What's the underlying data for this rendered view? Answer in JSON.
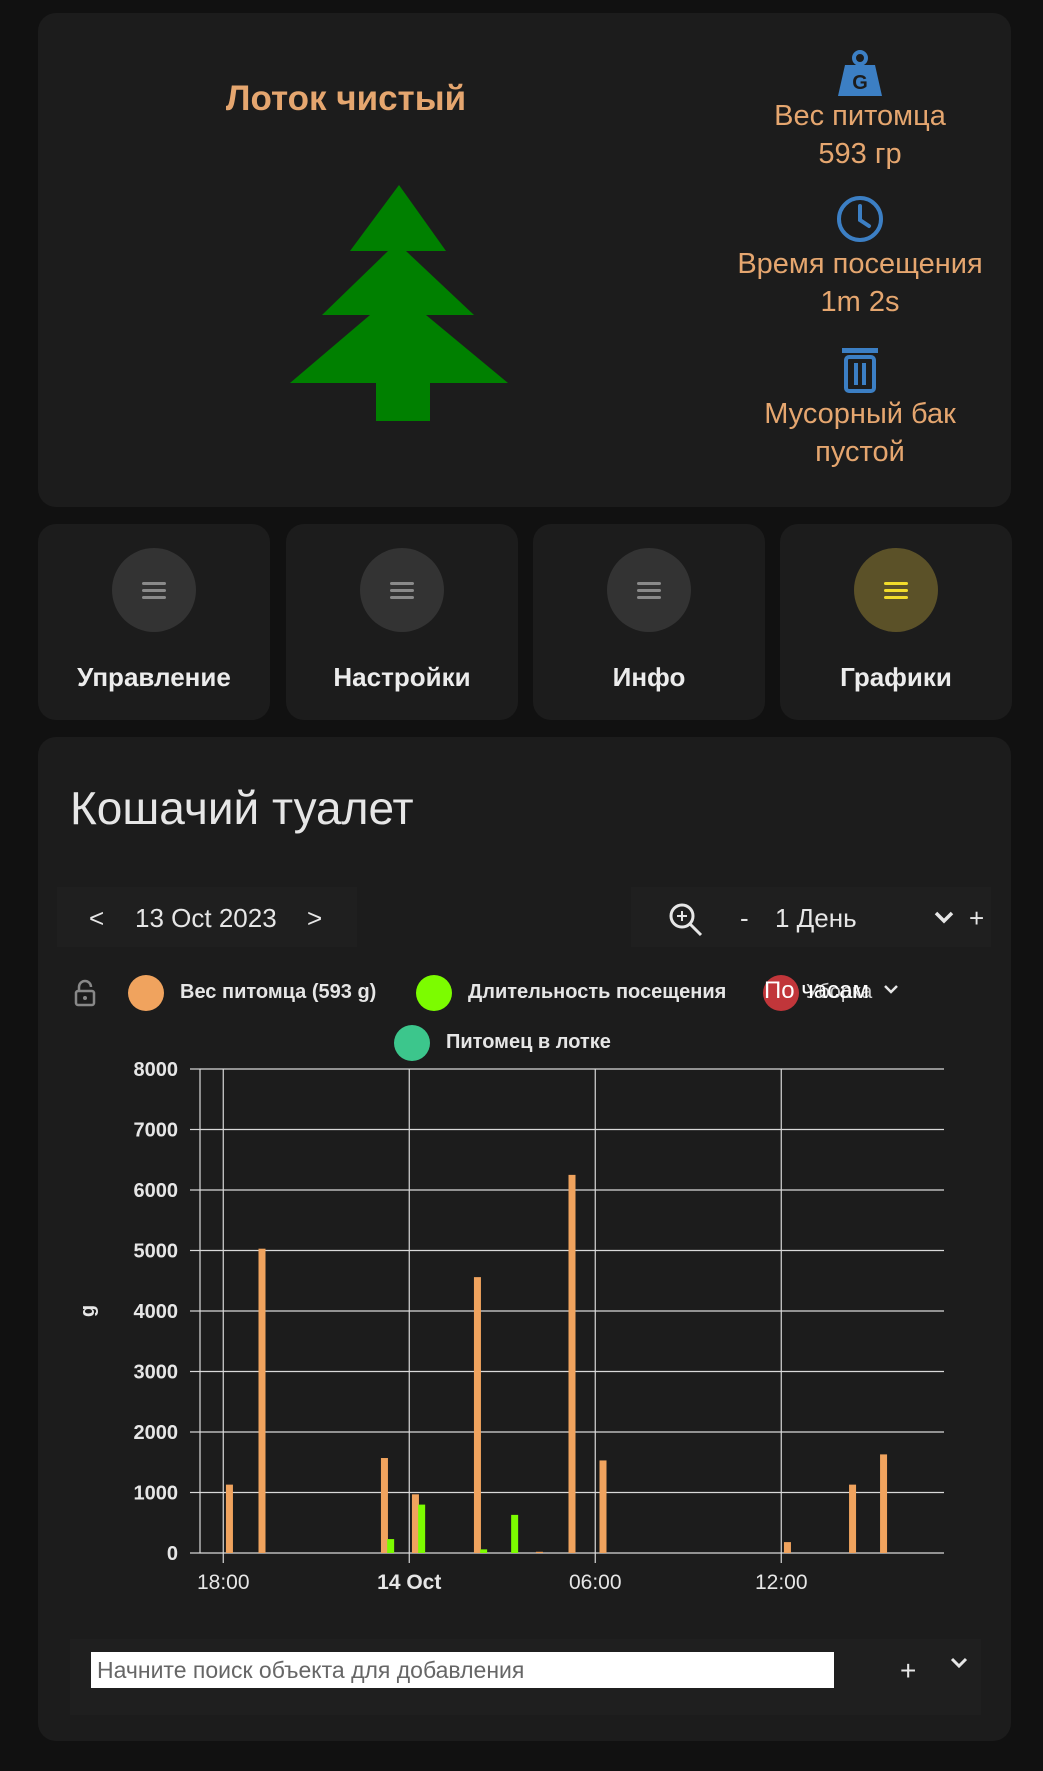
{
  "status": {
    "title": "Лоток чистый",
    "pet_weight_label": "Вес питомца",
    "pet_weight_value": "593 гр",
    "visit_time_label": "Время посещения",
    "visit_time_value": "1m 2s",
    "bin_label": "Мусорный бак",
    "bin_value": "пустой",
    "accent_color": "#e5a66f",
    "icon_color": "#3c7fc4"
  },
  "nav": {
    "tiles": [
      {
        "label": "Управление",
        "icon": "menu-icon",
        "active": false
      },
      {
        "label": "Настройки",
        "icon": "menu-icon",
        "active": false
      },
      {
        "label": "Инфо",
        "icon": "menu-icon",
        "active": false
      },
      {
        "label": "Графики",
        "icon": "menu-icon",
        "active": true
      }
    ]
  },
  "history": {
    "title": "Кошачий туалет",
    "date_prev": "<",
    "date": "13 Oct 2023",
    "date_next": ">",
    "zoom_minus": "-",
    "period": "1 День",
    "zoom_plus": "+",
    "search_placeholder": "Начните поиск объекта для добавления",
    "search_add": "+",
    "legend_overlap_text": "По часам",
    "legend_overlap_text2": "Уборка"
  },
  "chart_data": {
    "type": "bar",
    "ylabel": "g",
    "ylim": [
      0,
      8000
    ],
    "yticks": [
      0,
      1000,
      2000,
      3000,
      4000,
      5000,
      6000,
      7000,
      8000
    ],
    "xrange_hours": [
      -6.75,
      17.25
    ],
    "xticks": [
      {
        "h": -6,
        "label": "18:00",
        "bold": false
      },
      {
        "h": 0,
        "label": "14 Oct",
        "bold": true
      },
      {
        "h": 6,
        "label": "06:00",
        "bold": false
      },
      {
        "h": 12,
        "label": "12:00",
        "bold": false
      }
    ],
    "series": [
      {
        "name": "Вес питомца (593 g)",
        "color": "#f0a35e",
        "points": [
          {
            "h": -5.8,
            "v": 1130
          },
          {
            "h": -4.75,
            "v": 5030
          },
          {
            "h": -0.8,
            "v": 1570
          },
          {
            "h": 0.2,
            "v": 970
          },
          {
            "h": 2.2,
            "v": 4560
          },
          {
            "h": 4.2,
            "v": 20
          },
          {
            "h": 5.25,
            "v": 6250
          },
          {
            "h": 6.25,
            "v": 1530
          },
          {
            "h": 12.2,
            "v": 180
          },
          {
            "h": 14.3,
            "v": 1130
          },
          {
            "h": 15.3,
            "v": 1630
          }
        ]
      },
      {
        "name": "Длительность посещения",
        "color": "#7cfc00",
        "points": [
          {
            "h": -0.6,
            "v": 230
          },
          {
            "h": 0.4,
            "v": 800
          },
          {
            "h": 2.4,
            "v": 60
          },
          {
            "h": 3.4,
            "v": 630
          }
        ]
      },
      {
        "name": "Уборка",
        "color": "#c1363a",
        "points": []
      },
      {
        "name": "Питомец в лотке",
        "color": "#3cc68c",
        "points": []
      }
    ]
  }
}
